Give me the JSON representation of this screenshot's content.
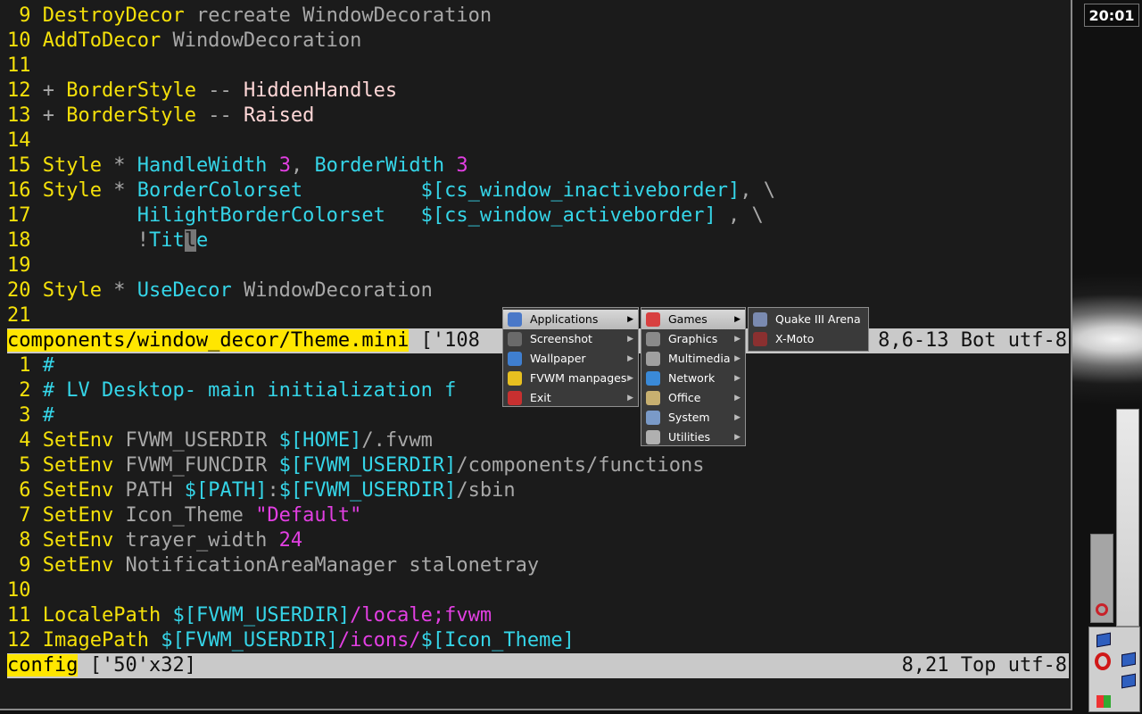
{
  "clock": "20:01",
  "editor_top": {
    "lines": [
      {
        "n": " 9",
        "parts": [
          {
            "t": "DestroyDecor",
            "c": "kw"
          },
          {
            "t": " recreate WindowDecoration",
            "c": "gy"
          }
        ]
      },
      {
        "n": "10",
        "parts": [
          {
            "t": "AddToDecor",
            "c": "kw"
          },
          {
            "t": " WindowDecoration",
            "c": "gy"
          }
        ]
      },
      {
        "n": "11",
        "parts": []
      },
      {
        "n": "12",
        "parts": [
          {
            "t": "+ ",
            "c": "gy"
          },
          {
            "t": "BorderStyle",
            "c": "kw"
          },
          {
            "t": " -- ",
            "c": "gy"
          },
          {
            "t": "HiddenHandles",
            "c": "pk"
          }
        ]
      },
      {
        "n": "13",
        "parts": [
          {
            "t": "+ ",
            "c": "gy"
          },
          {
            "t": "BorderStyle",
            "c": "kw"
          },
          {
            "t": " -- ",
            "c": "gy"
          },
          {
            "t": "Raised",
            "c": "pk"
          }
        ]
      },
      {
        "n": "14",
        "parts": []
      },
      {
        "n": "15",
        "parts": [
          {
            "t": "Style",
            "c": "kw"
          },
          {
            "t": " * ",
            "c": "gy"
          },
          {
            "t": "HandleWidth",
            "c": "cy"
          },
          {
            "t": " ",
            "c": "gy"
          },
          {
            "t": "3",
            "c": "mg"
          },
          {
            "t": ", ",
            "c": "gy"
          },
          {
            "t": "BorderWidth",
            "c": "cy"
          },
          {
            "t": " ",
            "c": "gy"
          },
          {
            "t": "3",
            "c": "mg"
          }
        ]
      },
      {
        "n": "16",
        "parts": [
          {
            "t": "Style",
            "c": "kw"
          },
          {
            "t": " * ",
            "c": "gy"
          },
          {
            "t": "BorderColorset",
            "c": "cy"
          },
          {
            "t": "          ",
            "c": "gy"
          },
          {
            "t": "$[cs_window_inactiveborder]",
            "c": "cy"
          },
          {
            "t": ", \\",
            "c": "gy"
          }
        ]
      },
      {
        "n": "17",
        "parts": [
          {
            "t": "        ",
            "c": "gy"
          },
          {
            "t": "HilightBorderColorset",
            "c": "cy"
          },
          {
            "t": "   ",
            "c": "gy"
          },
          {
            "t": "$[cs_window_activeborder]",
            "c": "cy"
          },
          {
            "t": " , \\",
            "c": "gy"
          }
        ]
      },
      {
        "n": "18",
        "parts": [
          {
            "t": "        !",
            "c": "gy"
          },
          {
            "t": "Tit",
            "c": "cy"
          },
          {
            "t": "l",
            "c": "cursor"
          },
          {
            "t": "e",
            "c": "cy"
          }
        ]
      },
      {
        "n": "19",
        "parts": []
      },
      {
        "n": "20",
        "parts": [
          {
            "t": "Style",
            "c": "kw"
          },
          {
            "t": " * ",
            "c": "gy"
          },
          {
            "t": "UseDecor",
            "c": "cy"
          },
          {
            "t": " WindowDecoration",
            "c": "gy"
          }
        ]
      },
      {
        "n": "21",
        "parts": []
      }
    ]
  },
  "status_top": {
    "filename": "components/window_decor/Theme.mini",
    "info": " ['108",
    "position": "8,6-13 Bot utf-8"
  },
  "editor_bottom": {
    "lines": [
      {
        "n": " 1",
        "parts": [
          {
            "t": "#",
            "c": "cy"
          }
        ]
      },
      {
        "n": " 2",
        "parts": [
          {
            "t": "# LV Desktop- main initialization f",
            "c": "cy"
          }
        ]
      },
      {
        "n": " 3",
        "parts": [
          {
            "t": "#",
            "c": "cy"
          }
        ]
      },
      {
        "n": " 4",
        "parts": [
          {
            "t": "SetEnv",
            "c": "kw"
          },
          {
            "t": " FVWM_USERDIR ",
            "c": "gy"
          },
          {
            "t": "$[HOME]",
            "c": "cy"
          },
          {
            "t": "/.fvwm",
            "c": "gy"
          }
        ]
      },
      {
        "n": " 5",
        "parts": [
          {
            "t": "SetEnv",
            "c": "kw"
          },
          {
            "t": " FVWM_FUNCDIR ",
            "c": "gy"
          },
          {
            "t": "$[FVWM_USERDIR]",
            "c": "cy"
          },
          {
            "t": "/components/functions",
            "c": "gy"
          }
        ]
      },
      {
        "n": " 6",
        "parts": [
          {
            "t": "SetEnv",
            "c": "kw"
          },
          {
            "t": " PATH ",
            "c": "gy"
          },
          {
            "t": "$[PATH]",
            "c": "cy"
          },
          {
            "t": ":",
            "c": "gy"
          },
          {
            "t": "$[FVWM_USERDIR]",
            "c": "cy"
          },
          {
            "t": "/sbin",
            "c": "gy"
          }
        ]
      },
      {
        "n": " 7",
        "parts": [
          {
            "t": "SetEnv",
            "c": "kw"
          },
          {
            "t": " Icon_Theme ",
            "c": "gy"
          },
          {
            "t": "\"Default\"",
            "c": "mg"
          }
        ]
      },
      {
        "n": " 8",
        "parts": [
          {
            "t": "SetEnv",
            "c": "kw"
          },
          {
            "t": " trayer_width ",
            "c": "gy"
          },
          {
            "t": "24",
            "c": "mg"
          }
        ]
      },
      {
        "n": " 9",
        "parts": [
          {
            "t": "SetEnv",
            "c": "kw"
          },
          {
            "t": " NotificationAreaManager stalonetray",
            "c": "gy"
          }
        ]
      },
      {
        "n": "10",
        "parts": []
      },
      {
        "n": "11",
        "parts": [
          {
            "t": "LocalePath",
            "c": "kw"
          },
          {
            "t": " ",
            "c": "gy"
          },
          {
            "t": "$[FVWM_USERDIR]",
            "c": "cy"
          },
          {
            "t": "/locale;fvwm",
            "c": "mg"
          }
        ]
      },
      {
        "n": "12",
        "parts": [
          {
            "t": "ImagePath",
            "c": "kw"
          },
          {
            "t": " ",
            "c": "gy"
          },
          {
            "t": "$[FVWM_USERDIR]",
            "c": "cy"
          },
          {
            "t": "/icons/",
            "c": "mg"
          },
          {
            "t": "$[Icon_Theme]",
            "c": "cy"
          }
        ]
      }
    ]
  },
  "status_bottom": {
    "filename": "config",
    "info": " ['50'x32]",
    "position": "8,21 Top utf-8"
  },
  "menus": {
    "root": [
      {
        "label": "Applications",
        "icon": "applications-icon",
        "color": "#4a78c8",
        "selected": true,
        "submenu": true
      },
      {
        "label": "Screenshot",
        "icon": "camera-icon",
        "color": "#6a6a6a",
        "submenu": true
      },
      {
        "label": "Wallpaper",
        "icon": "wallpaper-icon",
        "color": "#3f7fd0",
        "submenu": true
      },
      {
        "label": "FVWM manpages",
        "icon": "manpages-icon",
        "color": "#e8c020",
        "submenu": true
      },
      {
        "label": "Exit",
        "icon": "exit-icon",
        "color": "#c83030",
        "submenu": true
      }
    ],
    "applications": [
      {
        "label": "Games",
        "icon": "games-icon",
        "color": "#d84040",
        "selected": true,
        "submenu": true
      },
      {
        "label": "Graphics",
        "icon": "graphics-icon",
        "color": "#8a8a8a",
        "submenu": true
      },
      {
        "label": "Multimedia",
        "icon": "multimedia-icon",
        "color": "#a0a0a0",
        "submenu": true
      },
      {
        "label": "Network",
        "icon": "network-icon",
        "color": "#3a8ad8",
        "submenu": true
      },
      {
        "label": "Office",
        "icon": "office-icon",
        "color": "#c8b070",
        "submenu": true
      },
      {
        "label": "System",
        "icon": "system-icon",
        "color": "#7a9ac8",
        "submenu": true
      },
      {
        "label": "Utilities",
        "icon": "utilities-icon",
        "color": "#b0b0b0",
        "submenu": true
      }
    ],
    "games": [
      {
        "label": "Quake III Arena",
        "icon": "quake-icon",
        "color": "#7a8ab0"
      },
      {
        "label": "X-Moto",
        "icon": "xmoto-icon",
        "color": "#8a3030"
      }
    ]
  }
}
